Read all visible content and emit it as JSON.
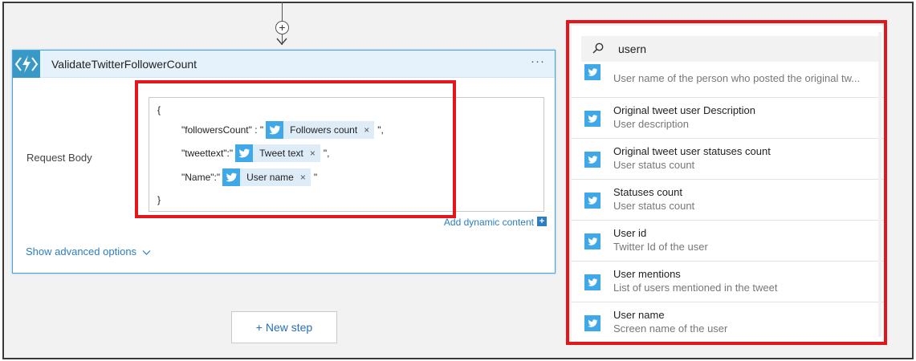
{
  "action": {
    "title": "ValidateTwitterFollowerCount",
    "menu": "···",
    "field_label": "Request Body",
    "body": {
      "open_brace": "{",
      "line1_key": "\"followersCount\" : \"",
      "line1_token": "Followers count",
      "line1_suffix": "\",",
      "line2_key": "\"tweettext\":\"",
      "line2_token": "Tweet text",
      "line2_suffix": "\",",
      "line3_key": "\"Name\":\"",
      "line3_token": "User name",
      "line3_suffix": "\"",
      "close_brace": "}",
      "token_close": "×"
    },
    "dynamic_link": "Add dynamic content",
    "dynamic_plus": "+",
    "show_advanced": "Show advanced options"
  },
  "connector": {
    "add_symbol": "+"
  },
  "new_step": "+ New step",
  "panel": {
    "search_value": "usern",
    "items": [
      {
        "title": "",
        "subtitle": "User name of the person who posted the original tw..."
      },
      {
        "title": "Original tweet user Description",
        "subtitle": "User description"
      },
      {
        "title": "Original tweet user statuses count",
        "subtitle": "User status count"
      },
      {
        "title": "Statuses count",
        "subtitle": "User status count"
      },
      {
        "title": "User id",
        "subtitle": "Twitter Id of the user"
      },
      {
        "title": "User mentions",
        "subtitle": "List of users mentioned in the tweet"
      },
      {
        "title": "User name",
        "subtitle": "Screen name of the user"
      }
    ]
  },
  "colors": {
    "accent": "#3999c6",
    "twitter": "#3ea8e8",
    "highlight": "#e3171b",
    "link": "#2b7ec1"
  }
}
